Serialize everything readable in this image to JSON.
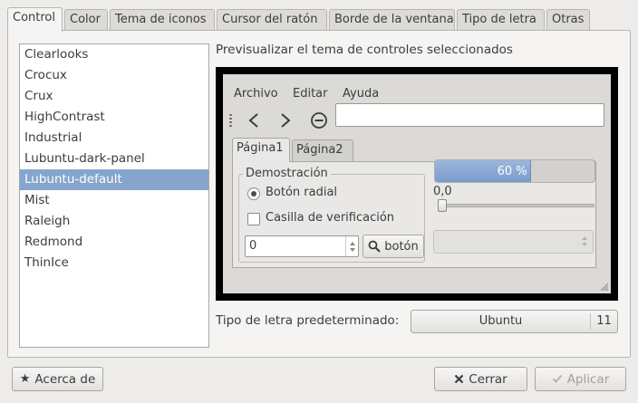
{
  "tabs": [
    {
      "label": "Control",
      "active": true
    },
    {
      "label": "Color"
    },
    {
      "label": "Tema de iconos"
    },
    {
      "label": "Cursor del ratón"
    },
    {
      "label": "Borde de la ventana"
    },
    {
      "label": "Tipo de letra"
    },
    {
      "label": "Otras"
    }
  ],
  "themes": [
    "Clearlooks",
    "Crocux",
    "Crux",
    "HighContrast",
    "Industrial",
    "Lubuntu-dark-panel",
    "Lubuntu-default",
    "Mist",
    "Raleigh",
    "Redmond",
    "ThinIce"
  ],
  "selected_theme": "Lubuntu-default",
  "preview": {
    "heading": "Previsualizar el tema de controles seleccionados",
    "menu": [
      "Archivo",
      "Editar",
      "Ayuda"
    ],
    "toolbar_icons": [
      "back-icon",
      "forward-icon",
      "stop-icon"
    ],
    "inner_tabs": [
      "Página1",
      "Página2"
    ],
    "fieldset_legend": "Demostración",
    "radio_label": "Botón radial",
    "radio_checked": true,
    "checkbox_label": "Casilla de verificación",
    "checkbox_checked": false,
    "spin_value": "0",
    "button_label": "botón",
    "progress_text": "60 %",
    "progress_value": 0.6,
    "scale_value_text": "0,0",
    "scale_value": 0
  },
  "font": {
    "label": "Tipo de letra predeterminado:",
    "name": "Ubuntu",
    "size": "11"
  },
  "buttons": {
    "about": "Acerca de",
    "close": "Cerrar",
    "apply": "Aplicar"
  },
  "colors": {
    "selection": "#86a5cd",
    "window_bg": "#edeceb",
    "progress": "#86a5cd"
  }
}
